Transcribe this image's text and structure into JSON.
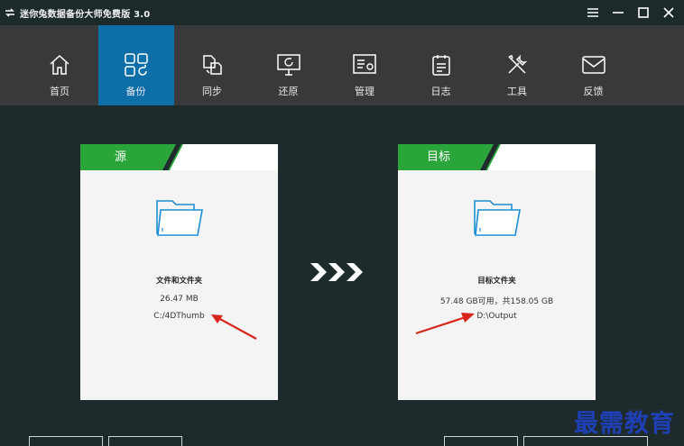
{
  "app": {
    "title": "迷你兔数据备份大师免费版 3.0",
    "logo_icon": "swap-arrows-icon"
  },
  "window_controls": [
    {
      "name": "menu-button",
      "icon": "hamburger-icon"
    },
    {
      "name": "minimize-button",
      "icon": "minimize-icon"
    },
    {
      "name": "maximize-button",
      "icon": "maximize-icon"
    },
    {
      "name": "close-button",
      "icon": "close-icon"
    }
  ],
  "toolbar": {
    "items": [
      {
        "label": "首页",
        "icon": "home-icon",
        "active": false
      },
      {
        "label": "备份",
        "icon": "backup-icon",
        "active": true
      },
      {
        "label": "同步",
        "icon": "sync-icon",
        "active": false
      },
      {
        "label": "还原",
        "icon": "restore-icon",
        "active": false
      },
      {
        "label": "管理",
        "icon": "manage-icon",
        "active": false
      },
      {
        "label": "日志",
        "icon": "log-icon",
        "active": false
      },
      {
        "label": "工具",
        "icon": "tools-icon",
        "active": false
      },
      {
        "label": "反馈",
        "icon": "feedback-icon",
        "active": false
      }
    ]
  },
  "source": {
    "tab_label": "源",
    "title": "文件和文件夹",
    "size": "26.47 MB",
    "path": "C:/4DThumb"
  },
  "destination": {
    "tab_label": "目标",
    "title": "目标文件夹",
    "space": "57.48 GB可用，共158.05 GB",
    "path": "D:\\Output"
  },
  "watermark": "最需教育",
  "colors": {
    "accent": "#0d6ea8",
    "tab_green": "#2aa53a",
    "background": "#1d2b2d",
    "toolbar": "#38393a",
    "annotation_red": "#d8261f",
    "watermark": "#1f3fb5"
  }
}
